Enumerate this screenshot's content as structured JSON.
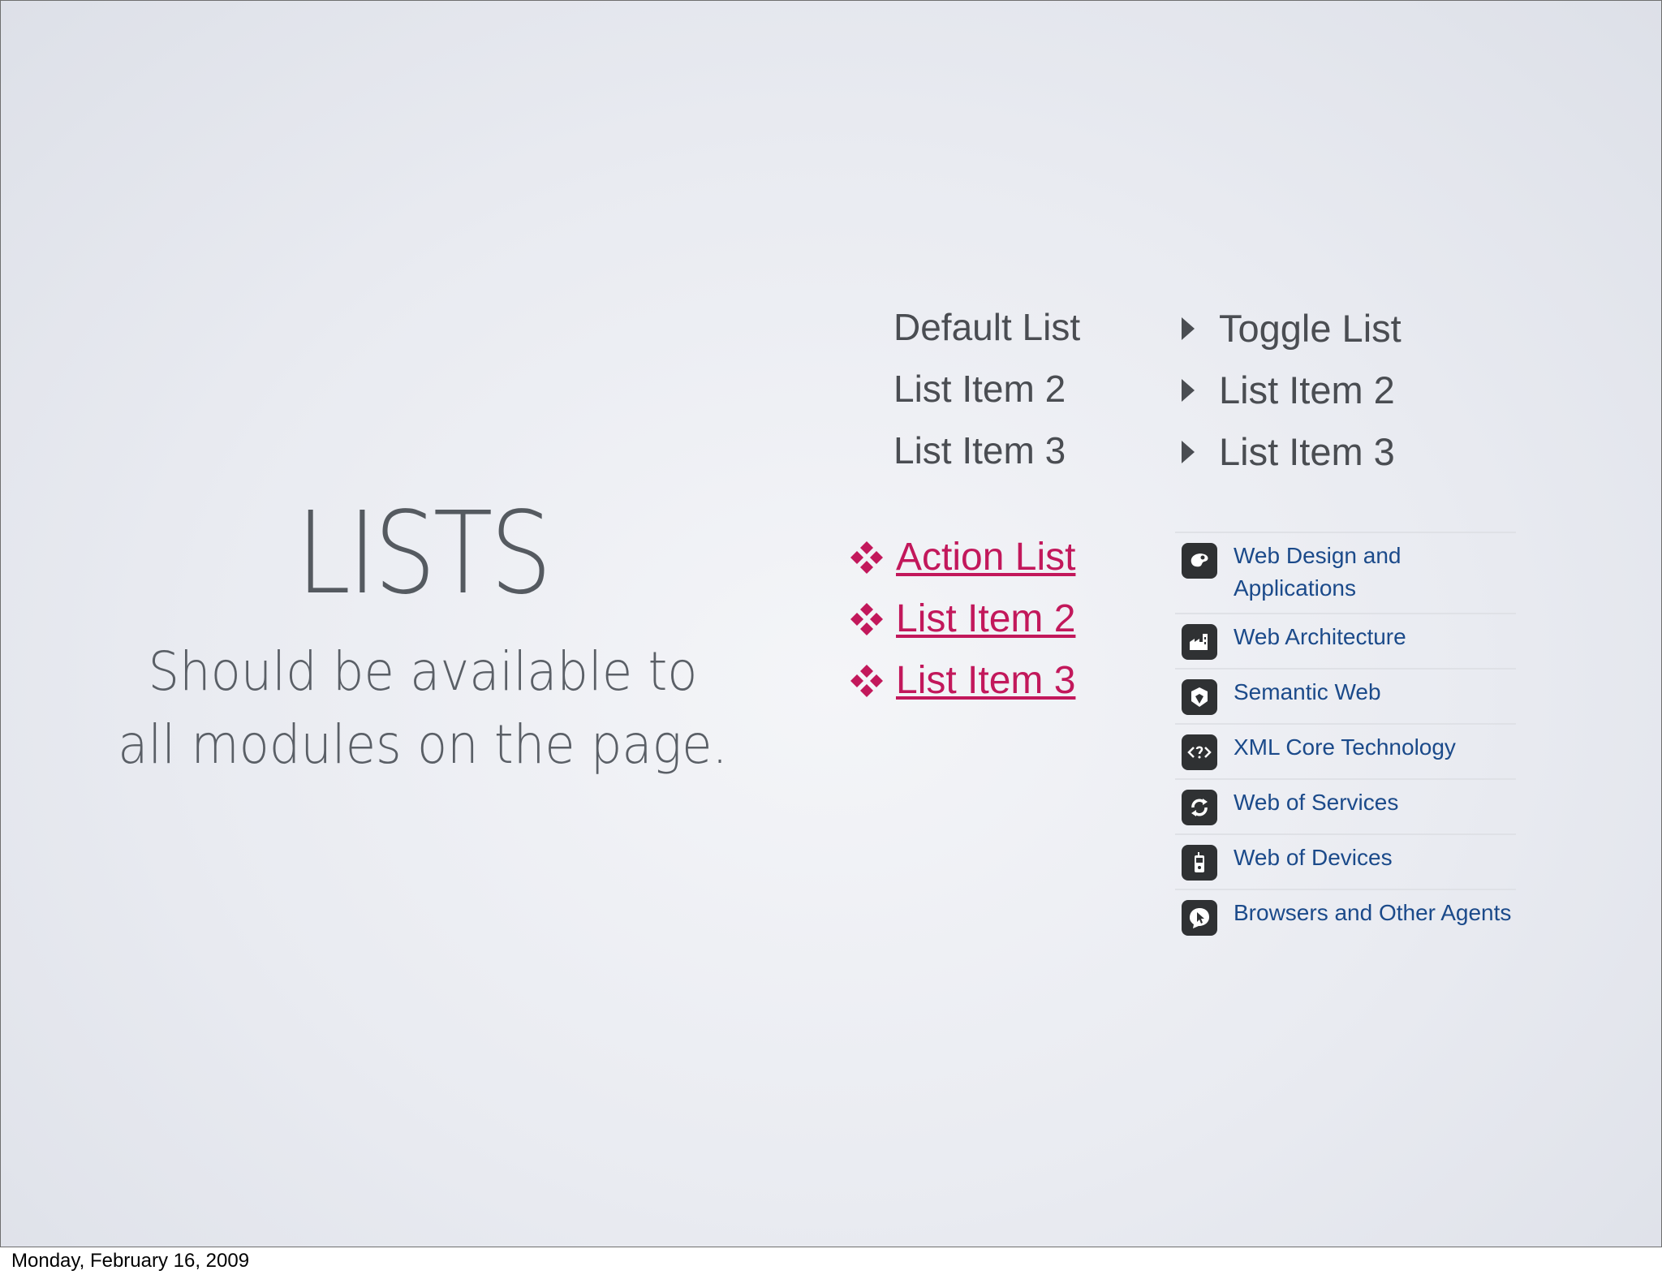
{
  "slide": {
    "title": "LISTS",
    "subtitle": "Should be available to all modules on the page."
  },
  "default_list": [
    "Default List",
    "List Item 2",
    "List Item 3"
  ],
  "toggle_list": [
    "Toggle List",
    "List Item 2",
    "List Item 3"
  ],
  "action_list": [
    "Action List",
    "List Item 2",
    "List Item 3"
  ],
  "w3c_list": [
    {
      "label": "Web Design and Applications",
      "icon": "palette-icon"
    },
    {
      "label": "Web Architecture",
      "icon": "building-icon"
    },
    {
      "label": "Semantic Web",
      "icon": "cube-icon"
    },
    {
      "label": "XML Core Technology",
      "icon": "xml-icon"
    },
    {
      "label": "Web of Services",
      "icon": "cycle-icon"
    },
    {
      "label": "Web of Devices",
      "icon": "phone-icon"
    },
    {
      "label": "Browsers and Other Agents",
      "icon": "speech-cursor-icon"
    }
  ],
  "colors": {
    "action": "#c2185b",
    "link": "#1b4a8a",
    "text": "#4a4d52"
  },
  "footer": "Monday, February 16, 2009"
}
